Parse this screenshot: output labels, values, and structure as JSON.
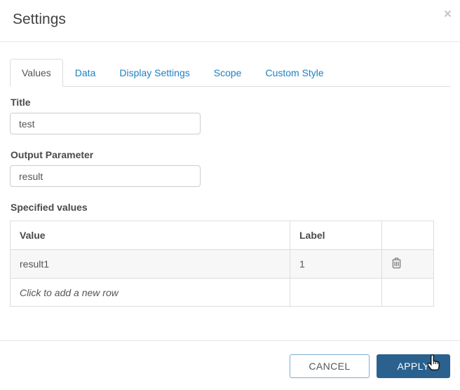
{
  "dialog": {
    "title": "Settings",
    "close_glyph": "×"
  },
  "tabs": [
    {
      "label": "Values",
      "active": true
    },
    {
      "label": "Data",
      "active": false
    },
    {
      "label": "Display Settings",
      "active": false
    },
    {
      "label": "Scope",
      "active": false
    },
    {
      "label": "Custom Style",
      "active": false
    }
  ],
  "form": {
    "title_label": "Title",
    "title_value": "test",
    "output_param_label": "Output Parameter",
    "output_param_value": "result",
    "specified_values_label": "Specified values"
  },
  "table": {
    "headers": [
      "Value",
      "Label",
      ""
    ],
    "rows": [
      {
        "value": "result1",
        "label": "1",
        "action_icon": "trash-icon"
      }
    ],
    "add_row_text": "Click to add a new row"
  },
  "footer": {
    "cancel_label": "CANCEL",
    "apply_label": "APPLY"
  },
  "cursor": {
    "type": "hand-pointer",
    "over": "apply-button"
  },
  "colors": {
    "tab_link": "#1d80c3",
    "apply_bg": "#2a618f",
    "cancel_border": "#79aed4",
    "table_row_bg": "#f7f7f7",
    "divider": "#e5e5e5"
  }
}
